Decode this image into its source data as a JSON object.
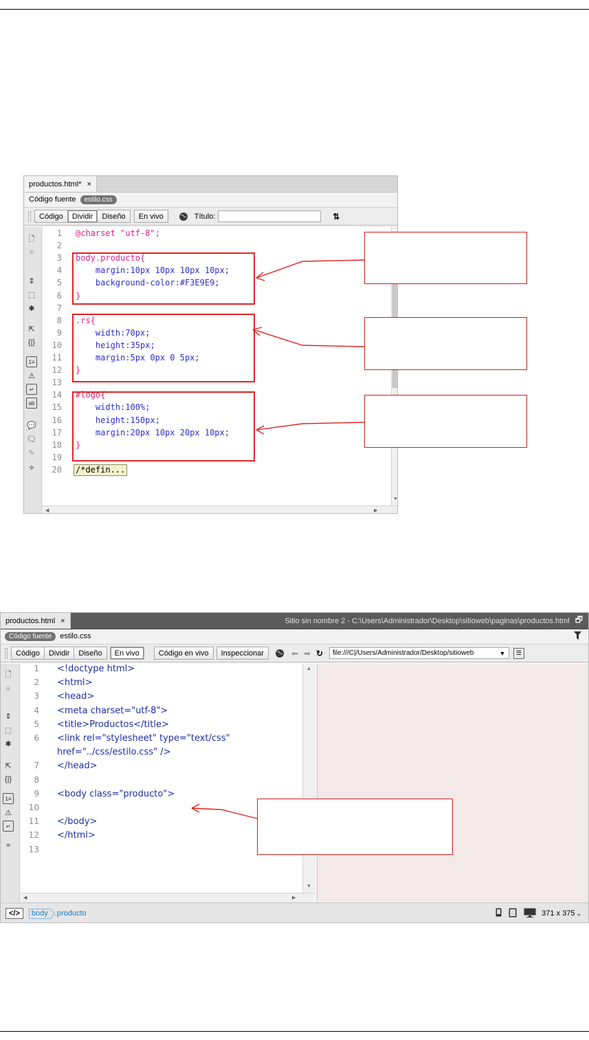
{
  "window1": {
    "tab_label": "productos.html*",
    "close_glyph": "×",
    "source_label": "Código fuente",
    "related_file": "estilo.css",
    "view_buttons": [
      "Código",
      "Dividir",
      "Diseño",
      "En vivo"
    ],
    "title_label": "Título:",
    "title_value": "",
    "active_view": "Dividir",
    "lines": [
      {
        "n": "1",
        "parts": [
          {
            "t": "@charset \"utf-8\";",
            "c": "at"
          }
        ]
      },
      {
        "n": "2",
        "parts": []
      },
      {
        "n": "3",
        "parts": [
          {
            "t": "body.producto{",
            "c": "sel"
          }
        ]
      },
      {
        "n": "4",
        "parts": [
          {
            "t": "    margin:10px 10px 10px 10px;",
            "c": "prop"
          }
        ]
      },
      {
        "n": "5",
        "parts": [
          {
            "t": "    background-color:#F3E9E9;",
            "c": "prop"
          }
        ]
      },
      {
        "n": "6",
        "parts": [
          {
            "t": "}",
            "c": "sel"
          }
        ]
      },
      {
        "n": "7",
        "parts": []
      },
      {
        "n": "8",
        "parts": [
          {
            "t": ".rs{",
            "c": "sel"
          }
        ]
      },
      {
        "n": "9",
        "parts": [
          {
            "t": "    width:70px;",
            "c": "prop"
          }
        ]
      },
      {
        "n": "10",
        "parts": [
          {
            "t": "    height:35px;",
            "c": "prop"
          }
        ]
      },
      {
        "n": "11",
        "parts": [
          {
            "t": "    margin:5px 0px 0 5px;",
            "c": "prop"
          }
        ]
      },
      {
        "n": "12",
        "parts": [
          {
            "t": "}",
            "c": "sel"
          }
        ]
      },
      {
        "n": "13",
        "parts": []
      },
      {
        "n": "14",
        "parts": [
          {
            "t": "#logo{",
            "c": "sel"
          }
        ]
      },
      {
        "n": "15",
        "parts": [
          {
            "t": "    width:100%;",
            "c": "prop"
          }
        ]
      },
      {
        "n": "16",
        "parts": [
          {
            "t": "    height:150px;",
            "c": "prop"
          }
        ]
      },
      {
        "n": "17",
        "parts": [
          {
            "t": "    margin:20px 10px 20px 10px;",
            "c": "prop"
          }
        ]
      },
      {
        "n": "18",
        "parts": [
          {
            "t": "}",
            "c": "sel"
          }
        ]
      },
      {
        "n": "19",
        "parts": []
      },
      {
        "n": "20",
        "parts": []
      }
    ],
    "folded_comment": "/*defin..."
  },
  "window2": {
    "tab_label": "productos.html",
    "close_glyph": "×",
    "site_path": "Sitio sin nombre 2 - C:\\Users\\Administrador\\Desktop\\sitioweb\\paginas\\productos.html",
    "source_label": "Código fuente",
    "related_file": "estilo.css",
    "view_buttons": [
      "Código",
      "Dividir",
      "Diseño",
      "En vivo"
    ],
    "active_view": "En vivo",
    "live_code_label": "Código en vivo",
    "inspect_label": "Inspeccionar",
    "url_value": "file:///C|/Users/Administrador/Desktop/sitioweb",
    "lines": [
      {
        "n": "1",
        "t": "<!doctype html>"
      },
      {
        "n": "2",
        "t": "<html>"
      },
      {
        "n": "3",
        "t": "<head>"
      },
      {
        "n": "4",
        "t": "<meta charset=\"utf-8\">"
      },
      {
        "n": "5",
        "t": "<title>Productos</title>"
      },
      {
        "n": "6",
        "t": "<link rel=\"stylesheet\" type=\"text/css\""
      },
      {
        "n": "",
        "t": "href=\"../css/estilo.css\" />"
      },
      {
        "n": "7",
        "t": "</head>"
      },
      {
        "n": "8",
        "t": ""
      },
      {
        "n": "9",
        "t": "<body class=\"producto\">"
      },
      {
        "n": "10",
        "t": ""
      },
      {
        "n": "11",
        "t": "</body>"
      },
      {
        "n": "12",
        "t": "</html>"
      },
      {
        "n": "13",
        "t": ""
      }
    ],
    "status": {
      "tag_selector": "</>",
      "crumb_tag": "body",
      "crumb_class": ".producto",
      "window_size": "371 x 375"
    }
  },
  "colors": {
    "selector": "#e0208f",
    "property": "#2f2fd0",
    "annotation": "#e02424",
    "preview_bg": "#F3E9E9"
  },
  "icons": [
    "close-icon",
    "globe-icon",
    "sort-icon",
    "back-arrow-icon",
    "forward-arrow-icon",
    "refresh-icon",
    "filter-icon",
    "restore-window-icon",
    "phone-icon",
    "tablet-icon",
    "desktop-icon",
    "chevron-down-icon"
  ]
}
